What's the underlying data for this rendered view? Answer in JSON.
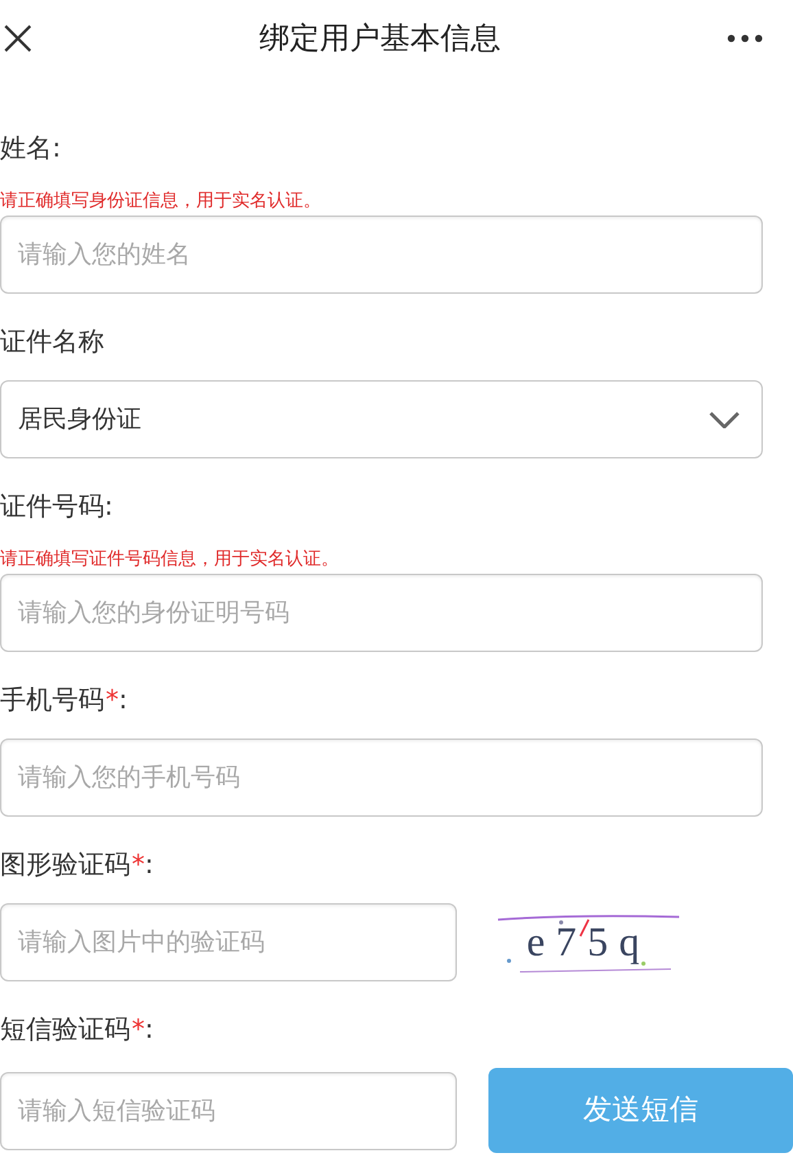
{
  "header": {
    "title": "绑定用户基本信息"
  },
  "fields": [
    {
      "kind": "text",
      "label": "姓名:",
      "hint": "请正确填写身份证信息，用于实名认证。",
      "placeholder": "请输入您的姓名"
    },
    {
      "kind": "select",
      "label": "证件名称",
      "value": "居民身份证"
    },
    {
      "kind": "text",
      "label": "证件号码:",
      "hint": "请正确填写证件号码信息，用于实名认证。",
      "placeholder": "请输入您的身份证明号码"
    },
    {
      "kind": "text",
      "label": "手机号码",
      "required_mark": "*",
      "suffix": ":",
      "placeholder": "请输入您的手机号码"
    },
    {
      "kind": "captcha",
      "label": "图形验证码",
      "required_mark": "*",
      "suffix": ":",
      "placeholder": "请输入图片中的验证码",
      "code": "e75q"
    },
    {
      "kind": "sms",
      "label": "短信验证码",
      "required_mark": "*",
      "suffix": ":",
      "placeholder": "请输入短信验证码",
      "button": "发送短信"
    }
  ]
}
